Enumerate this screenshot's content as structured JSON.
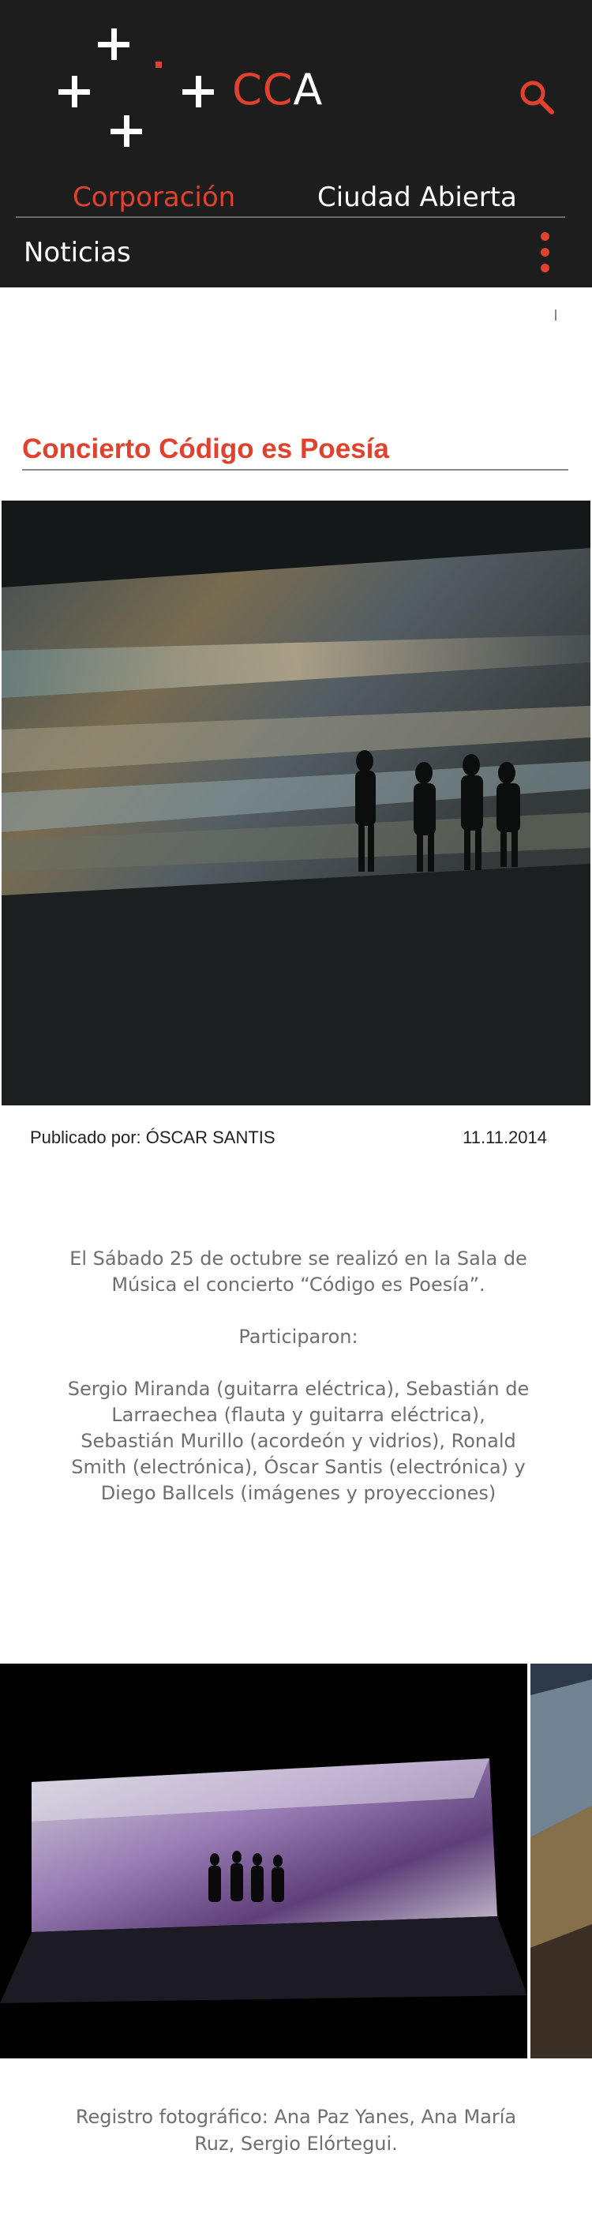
{
  "brand": {
    "logo_name": "CCA",
    "logo_letters_red": "CC",
    "logo_letters_white": "A",
    "accent_color": "#e0422d",
    "header_bg": "#1d1d1d"
  },
  "header": {
    "search_icon": "search-icon",
    "nav": {
      "corporacion": "Corporación",
      "ciudad_abierta": "Ciudad Abierta"
    },
    "section_title": "Noticias",
    "menu_icon": "vertical-dots-icon"
  },
  "post": {
    "title": "Concierto Código es Poesía",
    "author_label": "Publicado por: ÓSCAR SANTIS",
    "date": "11.11.2014",
    "paragraphs": [
      "El Sábado 25 de octubre se realizó en la Sala de Música el concierto “Código es Poesía”.",
      "Participaron:",
      "Sergio Miranda (guitarra eléctrica), Sebastián de Larraechea (flauta y guitarra eléctrica), Sebastián Murillo (acordeón y vidrios), Ronald Smith (electrónica), Óscar Santis (electrónica) y Diego Ballcels (imágenes y proyecciones)"
    ],
    "credits": "Registro fotográfico: Ana Paz Yanes, Ana María Ruz, Sergio Elórtegui."
  }
}
